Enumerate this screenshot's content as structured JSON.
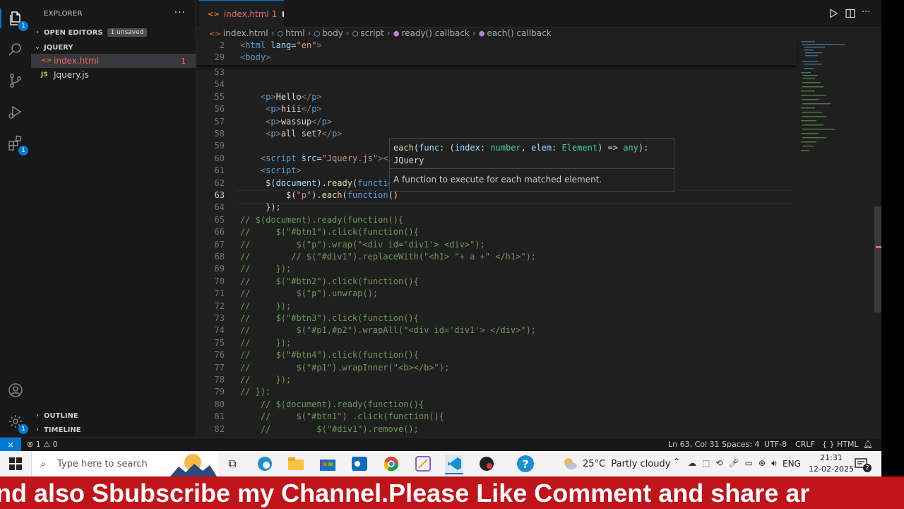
{
  "explorer": {
    "title": "EXPLORER",
    "more": "···",
    "open_editors": "OPEN EDITORS",
    "unsaved_badge": "1 unsaved",
    "folder": "JQUERY",
    "files": [
      {
        "icon": "<>",
        "name": "index.html",
        "problems": "1"
      },
      {
        "icon": "JS",
        "name": "Jquery.js",
        "problems": ""
      }
    ],
    "outline": "OUTLINE",
    "timeline": "TIMELINE"
  },
  "activity_badges": {
    "explorer": "1",
    "extensions": "1",
    "manage": "1"
  },
  "tab": {
    "icon": "<>",
    "name": "index.html",
    "problems": "1"
  },
  "breadcrumb": [
    "index.html",
    "html",
    "body",
    "script",
    "ready() callback",
    "each() callback"
  ],
  "sticky": [
    {
      "num": "2",
      "code": "<html lang=\"en\">"
    },
    {
      "num": "29",
      "code": "<body>"
    }
  ],
  "lines": [
    {
      "num": "53",
      "code": ""
    },
    {
      "num": "54",
      "code": ""
    },
    {
      "num": "55",
      "code": "    <p>Hello</p>"
    },
    {
      "num": "56",
      "code": "     <p>hiii</p>"
    },
    {
      "num": "57",
      "code": "     <p>wassup</p>"
    },
    {
      "num": "58",
      "code": "     <p>all set?</p>"
    },
    {
      "num": "59",
      "code": ""
    },
    {
      "num": "60",
      "code": "    <script src=\"Jquery.js\"></s"
    },
    {
      "num": "61",
      "code": "    <script>"
    },
    {
      "num": "62",
      "code": "     $(document).ready(function"
    },
    {
      "num": "63",
      "code": "         $(\"p\").each(function()"
    },
    {
      "num": "64",
      "code": "     });"
    },
    {
      "num": "65",
      "code": "// $(document).ready(function(){"
    },
    {
      "num": "66",
      "code": "//     $(\"#btn1\").click(function(){"
    },
    {
      "num": "67",
      "code": "//         $(\"p\").wrap(\"<div id='div1'> <div>\");"
    },
    {
      "num": "68",
      "code": "//        // $(\"#div1\").replaceWith(\"<h1> \"+ a +\" </h1>\");"
    },
    {
      "num": "69",
      "code": "//     });"
    },
    {
      "num": "70",
      "code": "//     $(\"#btn2\").click(function(){"
    },
    {
      "num": "71",
      "code": "//         $(\"p\").unwrap();"
    },
    {
      "num": "72",
      "code": "//     });"
    },
    {
      "num": "73",
      "code": "//     $(\"#btn3\").click(function(){"
    },
    {
      "num": "74",
      "code": "//         $(\"#p1,#p2\").wrapAll(\"<div id='div1'> </div>\");"
    },
    {
      "num": "75",
      "code": "//     });"
    },
    {
      "num": "76",
      "code": "//     $(\"#btn4\").click(function(){"
    },
    {
      "num": "77",
      "code": "//         $(\"#p1\").wrapInner(\"<b></b>\");"
    },
    {
      "num": "78",
      "code": "//     });"
    },
    {
      "num": "79",
      "code": "// });"
    },
    {
      "num": "80",
      "code": "    // $(document).ready(function(){"
    },
    {
      "num": "81",
      "code": "    //     $(\"#btn1\") .click(function(){"
    },
    {
      "num": "82",
      "code": "    //         $(\"#div1\").remove();"
    }
  ],
  "hover": {
    "signature_line1": "each(func: (index: number, elem: Element) => any):",
    "signature_line2": "JQuery",
    "doc": "A function to execute for each matched element."
  },
  "status": {
    "errors": "1",
    "warnings": "0",
    "position": "Ln 63, Col 31",
    "spaces": "Spaces: 4",
    "encoding": "UTF-8",
    "eol": "CRLF",
    "language": "HTML"
  },
  "taskbar": {
    "search_placeholder": "Type here to search",
    "weather": "25°C  Partly cloudy",
    "lang": "ENG",
    "time": "21:31",
    "date": "12-02-2025",
    "notifications": "2"
  },
  "banner": "nd also Sbubscribe my Channel.Please Like Comment and share ar",
  "colors": {
    "accent": "#0078d4",
    "error": "#e86c68",
    "banner": "#c0141b"
  }
}
